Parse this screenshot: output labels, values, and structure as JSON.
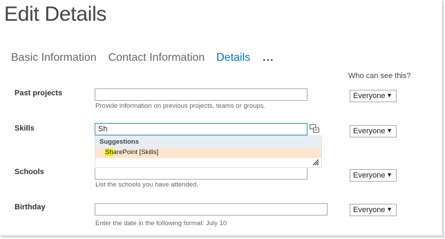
{
  "page": {
    "title": "Edit Details"
  },
  "tabs": [
    {
      "label": "Basic Information",
      "active": false
    },
    {
      "label": "Contact Information",
      "active": false
    },
    {
      "label": "Details",
      "active": true
    },
    {
      "label": "...",
      "active": false
    }
  ],
  "visibility_header": "Who can see this?",
  "fields": {
    "past_projects": {
      "label": "Past projects",
      "value": "",
      "hint": "Provide information on previous projects, teams or groups.",
      "visibility": "Everyone"
    },
    "skills": {
      "label": "Skills",
      "value": "Sh",
      "visibility": "Everyone"
    },
    "schools": {
      "label": "Schools",
      "value": "",
      "hint": "List the schools you have attended.",
      "visibility": "Everyone"
    },
    "birthday": {
      "label": "Birthday",
      "value": "",
      "hint": "Enter the date in the following format: July 10",
      "visibility": "Everyone"
    }
  },
  "suggestions": {
    "header": "Suggestions",
    "items": [
      {
        "match": "Sh",
        "rest": "arePoint",
        "tag": "[Skills]"
      }
    ]
  },
  "colors": {
    "accent": "#0072c6",
    "suggestion_bg": "#fde6d1",
    "highlight": "#f7ed00",
    "suggest_header_bg": "#e8eef6"
  },
  "icons": {
    "dropdown": "triangle-down",
    "contact_lookup": "address-book-icon",
    "resize": "resize-grip-icon"
  }
}
